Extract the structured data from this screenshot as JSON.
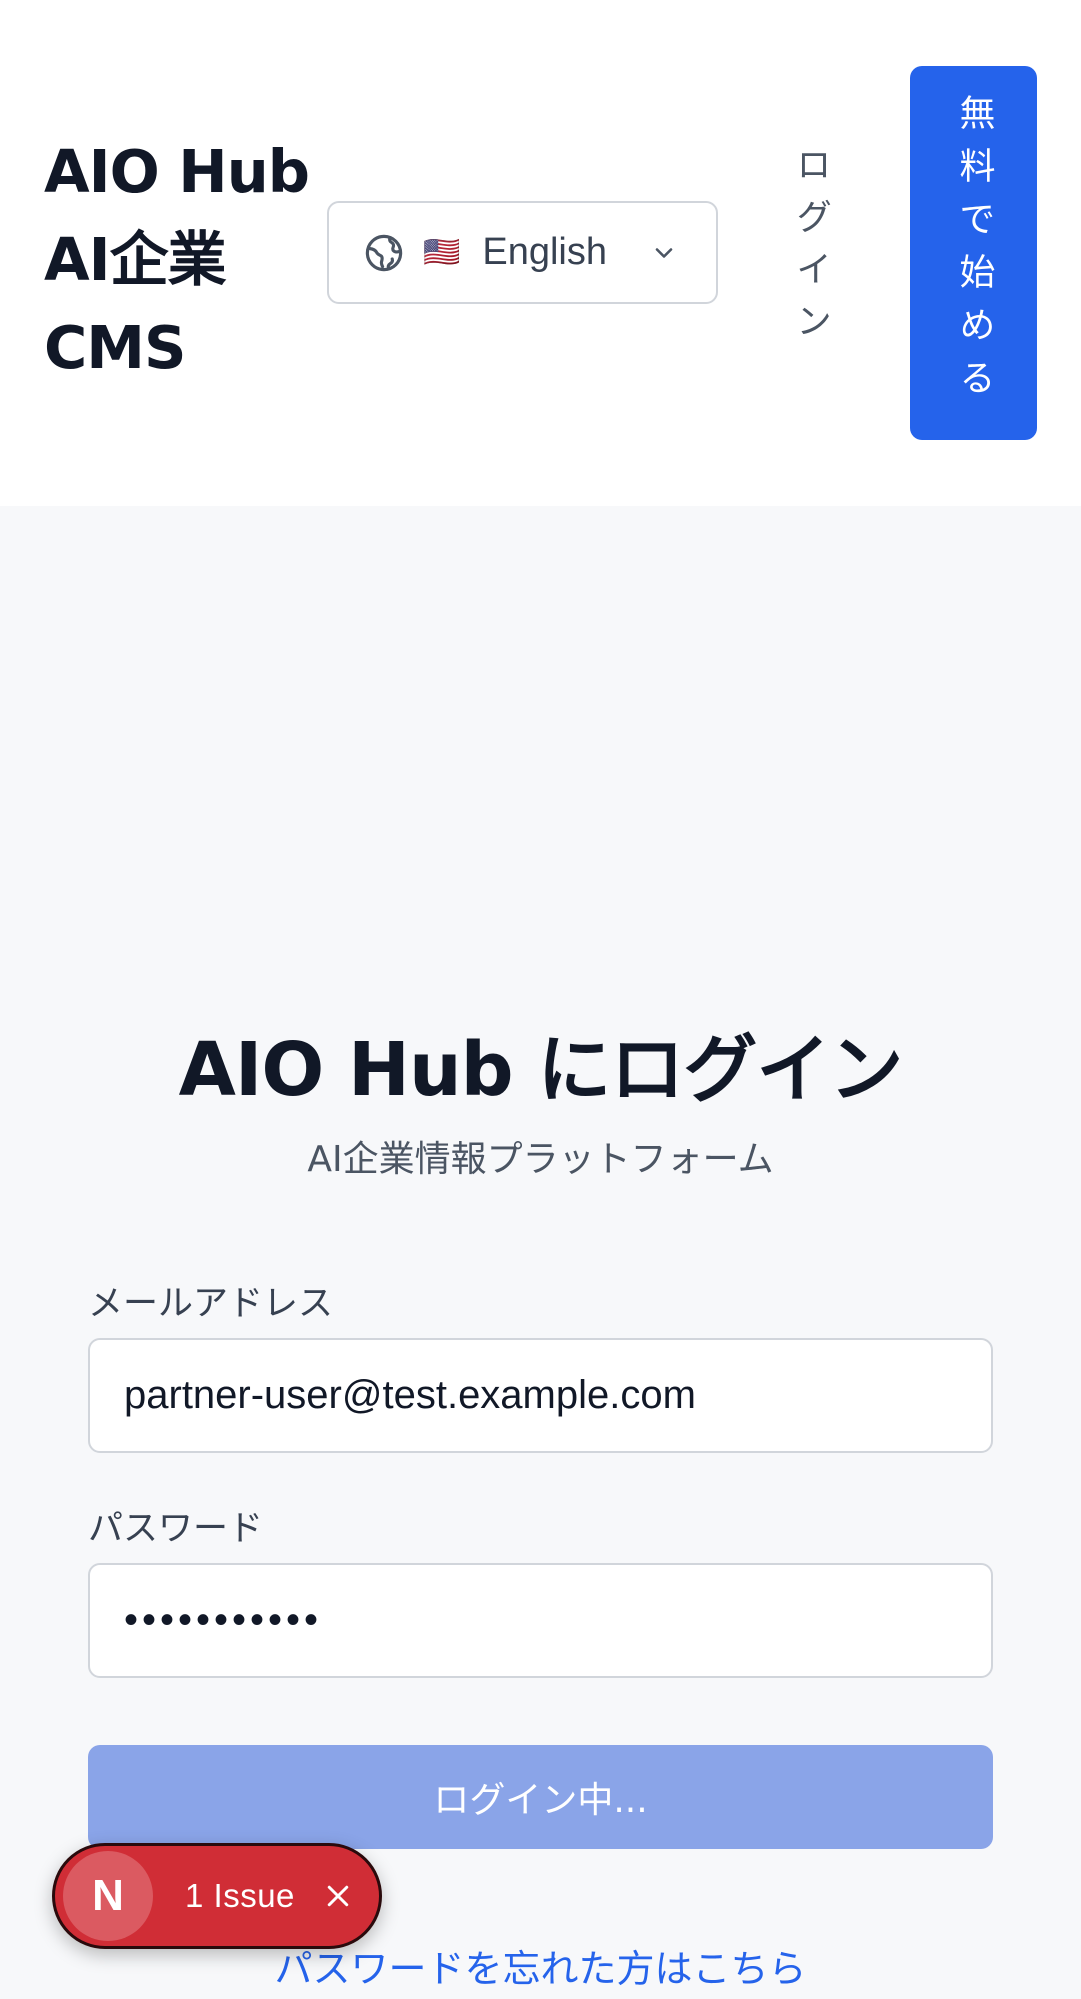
{
  "header": {
    "brand_line1": "AIO Hub",
    "brand_line2": "AI企業",
    "brand_line3": "CMS",
    "language": {
      "flag": "🇺🇸",
      "label": "English",
      "icon": "globe-icon"
    },
    "login_link": "ログイン",
    "start_button": "無料で始める"
  },
  "main": {
    "title": "AIO Hub にログイン",
    "subtitle": "AI企業情報プラットフォーム",
    "email": {
      "label": "メールアドレス",
      "value": "partner-user@test.example.com"
    },
    "password": {
      "label": "パスワード",
      "masked_value": "•••••••••••"
    },
    "submit_label": "ログイン中...",
    "forgot_link": "パスワードを忘れた方はこちら"
  },
  "dev_overlay": {
    "logo_letter": "N",
    "issue_text": "1 Issue"
  },
  "colors": {
    "accent": "#2563eb",
    "submit_disabled": "#8aa4e8",
    "issue_red": "#d02d36",
    "page_bg": "#f7f8fa"
  }
}
